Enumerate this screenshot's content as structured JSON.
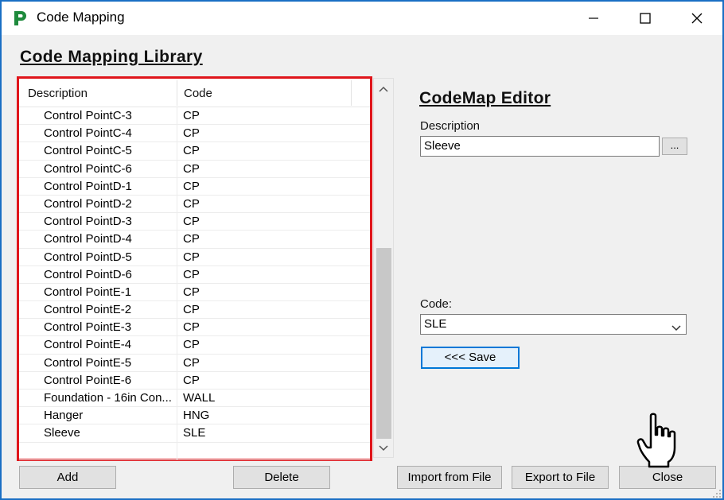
{
  "window": {
    "title": "Code Mapping",
    "icon": "p-logo-icon",
    "controls": [
      "minimize-icon",
      "maximize-icon",
      "close-icon"
    ]
  },
  "library": {
    "title": "Code Mapping Library",
    "columns": [
      "Description",
      "Code"
    ],
    "rows": [
      {
        "description": "Control PointC-3",
        "code": "CP"
      },
      {
        "description": "Control PointC-4",
        "code": "CP"
      },
      {
        "description": "Control PointC-5",
        "code": "CP"
      },
      {
        "description": "Control PointC-6",
        "code": "CP"
      },
      {
        "description": "Control PointD-1",
        "code": "CP"
      },
      {
        "description": "Control PointD-2",
        "code": "CP"
      },
      {
        "description": "Control PointD-3",
        "code": "CP"
      },
      {
        "description": "Control PointD-4",
        "code": "CP"
      },
      {
        "description": "Control PointD-5",
        "code": "CP"
      },
      {
        "description": "Control PointD-6",
        "code": "CP"
      },
      {
        "description": "Control PointE-1",
        "code": "CP"
      },
      {
        "description": "Control PointE-2",
        "code": "CP"
      },
      {
        "description": "Control PointE-3",
        "code": "CP"
      },
      {
        "description": "Control PointE-4",
        "code": "CP"
      },
      {
        "description": "Control PointE-5",
        "code": "CP"
      },
      {
        "description": "Control PointE-6",
        "code": "CP"
      },
      {
        "description": "Foundation - 16in Con...",
        "code": "WALL"
      },
      {
        "description": "Hanger",
        "code": "HNG"
      },
      {
        "description": "Sleeve",
        "code": "SLE"
      },
      {
        "description": "",
        "code": ""
      }
    ],
    "highlight_color": "#e0151b"
  },
  "editor": {
    "title": "CodeMap Editor",
    "description_label": "Description",
    "description_value": "Sleeve",
    "browse_label": "...",
    "code_label": "Code:",
    "code_value": "SLE",
    "save_label": "<<< Save"
  },
  "buttons": {
    "add": "Add",
    "delete": "Delete",
    "import": "Import from File",
    "export": "Export to File",
    "close": "Close"
  },
  "colors": {
    "window_border": "#1a6fc4",
    "accent": "#0078d7",
    "logo_green": "#1e8a3c"
  }
}
